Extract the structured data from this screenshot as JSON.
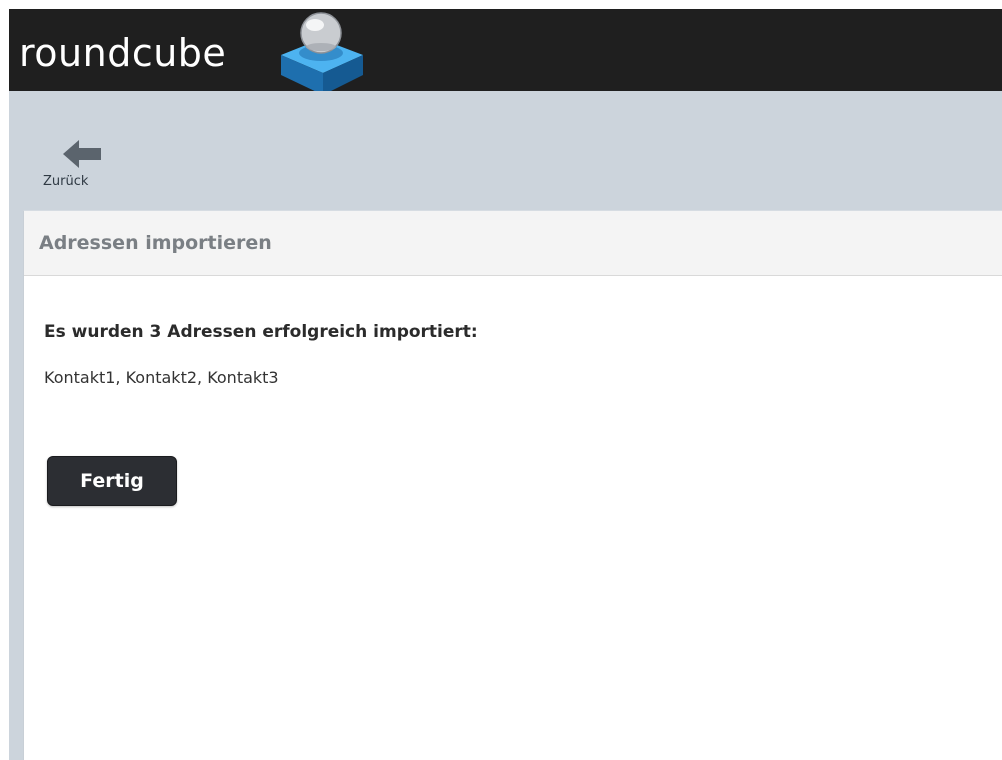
{
  "header": {
    "logo_text": "roundcube",
    "logo_icon": "roundcube-cube-logo-icon"
  },
  "toolbar": {
    "back_label": "Zurück",
    "back_icon": "arrow-left-icon"
  },
  "panel": {
    "title": "Adressen importieren",
    "result_heading": "Es wurden 3 Adressen erfolgreich importiert:",
    "imported_contacts": "Kontakt1, Kontakt2, Kontakt3",
    "done_label": "Fertig"
  },
  "colors": {
    "header_bg": "#1f1f1f",
    "toolbar_bg": "#ccd4dc",
    "panel_header_bg": "#f4f4f4",
    "button_bg": "#2c2e33",
    "cube_blue": "#2a8fd1"
  }
}
